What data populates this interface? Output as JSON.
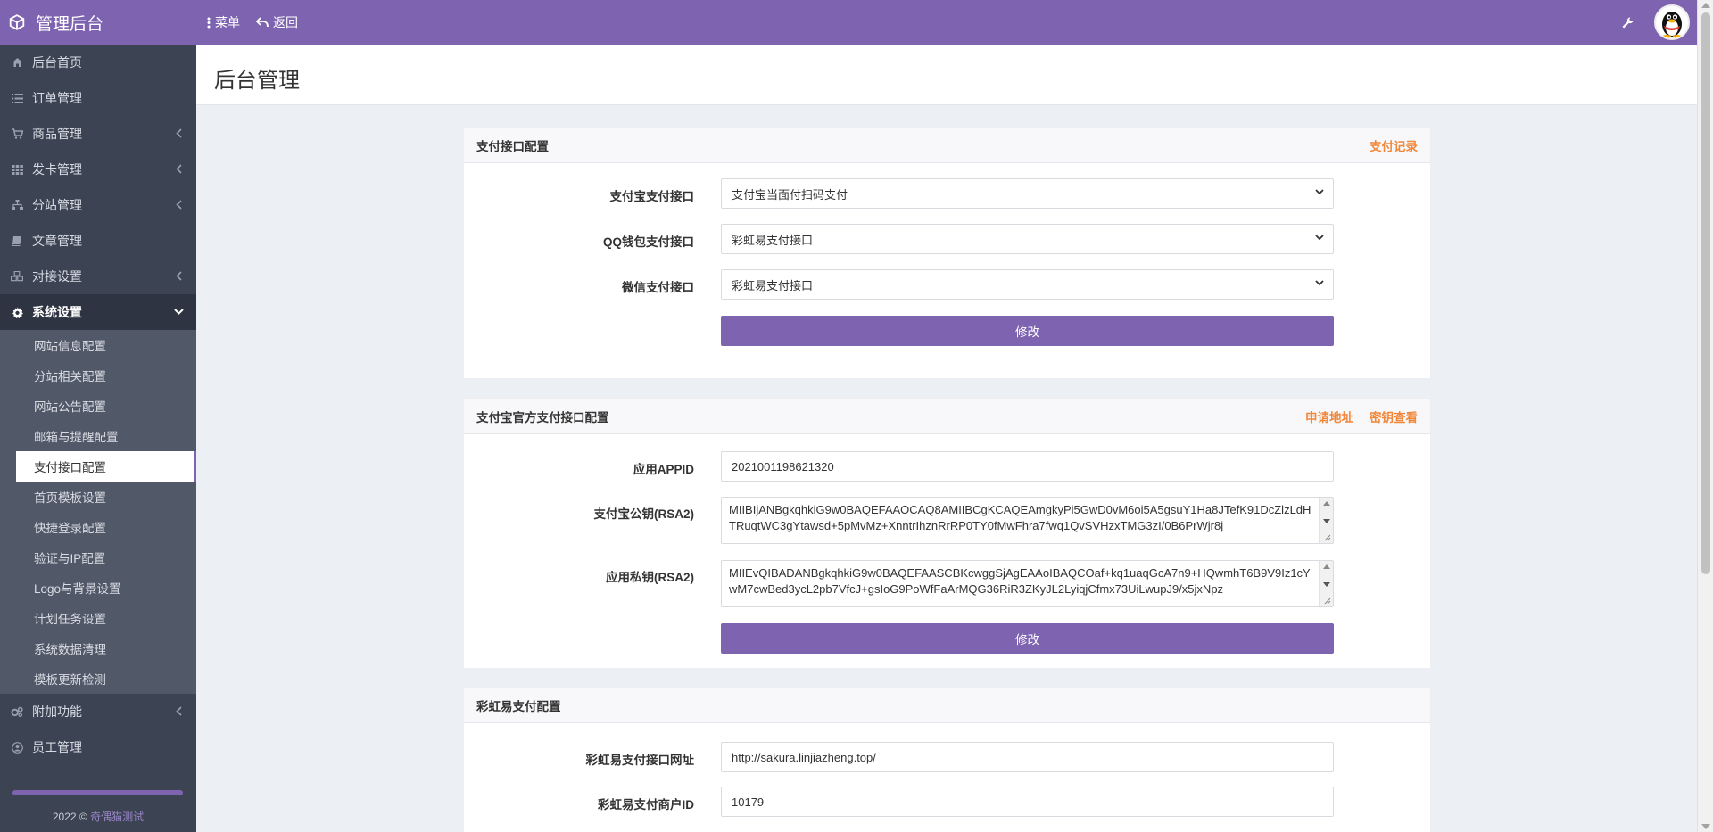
{
  "brand": {
    "title": "管理后台"
  },
  "topnav": {
    "menu": "菜单",
    "back": "返回"
  },
  "sidebar": {
    "items": [
      {
        "label": "后台首页",
        "icon": "home-icon"
      },
      {
        "label": "订单管理",
        "icon": "list-icon"
      },
      {
        "label": "商品管理",
        "icon": "cart-icon"
      },
      {
        "label": "发卡管理",
        "icon": "grid-icon"
      },
      {
        "label": "分站管理",
        "icon": "sitemap-icon"
      },
      {
        "label": "文章管理",
        "icon": "book-icon"
      },
      {
        "label": "对接设置",
        "icon": "cubes-icon"
      },
      {
        "label": "系统设置",
        "icon": "gear-icon"
      }
    ],
    "sub_items": [
      "网站信息配置",
      "分站相关配置",
      "网站公告配置",
      "邮箱与提醒配置",
      "支付接口配置",
      "首页模板设置",
      "快捷登录配置",
      "验证与IP配置",
      "Logo与背景设置",
      "计划任务设置",
      "系统数据清理",
      "模板更新检测"
    ],
    "bottom_items": [
      {
        "label": "附加功能",
        "icon": "gears-icon"
      },
      {
        "label": "员工管理",
        "icon": "user-icon"
      }
    ],
    "footer_year": "2022 ©",
    "footer_link": "奇偶猫测试"
  },
  "page": {
    "title": "后台管理"
  },
  "panel1": {
    "title": "支付接口配置",
    "link": "支付记录",
    "rows": [
      {
        "label": "支付宝支付接口",
        "value": "支付宝当面付扫码支付"
      },
      {
        "label": "QQ钱包支付接口",
        "value": "彩虹易支付接口"
      },
      {
        "label": "微信支付接口",
        "value": "彩虹易支付接口"
      }
    ],
    "button": "修改"
  },
  "panel2": {
    "title": "支付宝官方支付接口配置",
    "link1": "申请地址",
    "link2": "密钥查看",
    "appid_label": "应用APPID",
    "appid_value": "2021001198621320",
    "pubkey_label": "支付宝公钥(RSA2)",
    "pubkey_value": "MIIBIjANBgkqhkiG9w0BAQEFAAOCAQ8AMIIBCgKCAQEAmgkyPi5GwD0vM6oi5A5gsuY1Ha8JTefK91DcZlzLdHTRuqtWC3gYtawsd+5pMvMz+XnntrIhznRrRP0TY0fMwFhra7fwq1QvSVHzxTMG3zI/0B6PrWjr8j",
    "privkey_label": "应用私钥(RSA2)",
    "privkey_value": "MIIEvQIBADANBgkqhkiG9w0BAQEFAASCBKcwggSjAgEAAoIBAQCOaf+kq1uaqGcA7n9+HQwmhT6B9V9Iz1cYwM7cwBed3ycL2pb7VfcJ+gsIoG9PoWfFaArMQG36RiR3ZKyJL2LyiqjCfmx73UiLwupJ9/x5jxNpz",
    "button": "修改"
  },
  "panel3": {
    "title": "彩虹易支付配置",
    "url_label": "彩虹易支付接口网址",
    "url_value": "http://sakura.linjiazheng.top/",
    "pid_label": "彩虹易支付商户ID",
    "pid_value": "10179"
  },
  "colors": {
    "accent": "#7e64b0",
    "sidebar": "#3c4353",
    "link": "#f0883c"
  }
}
